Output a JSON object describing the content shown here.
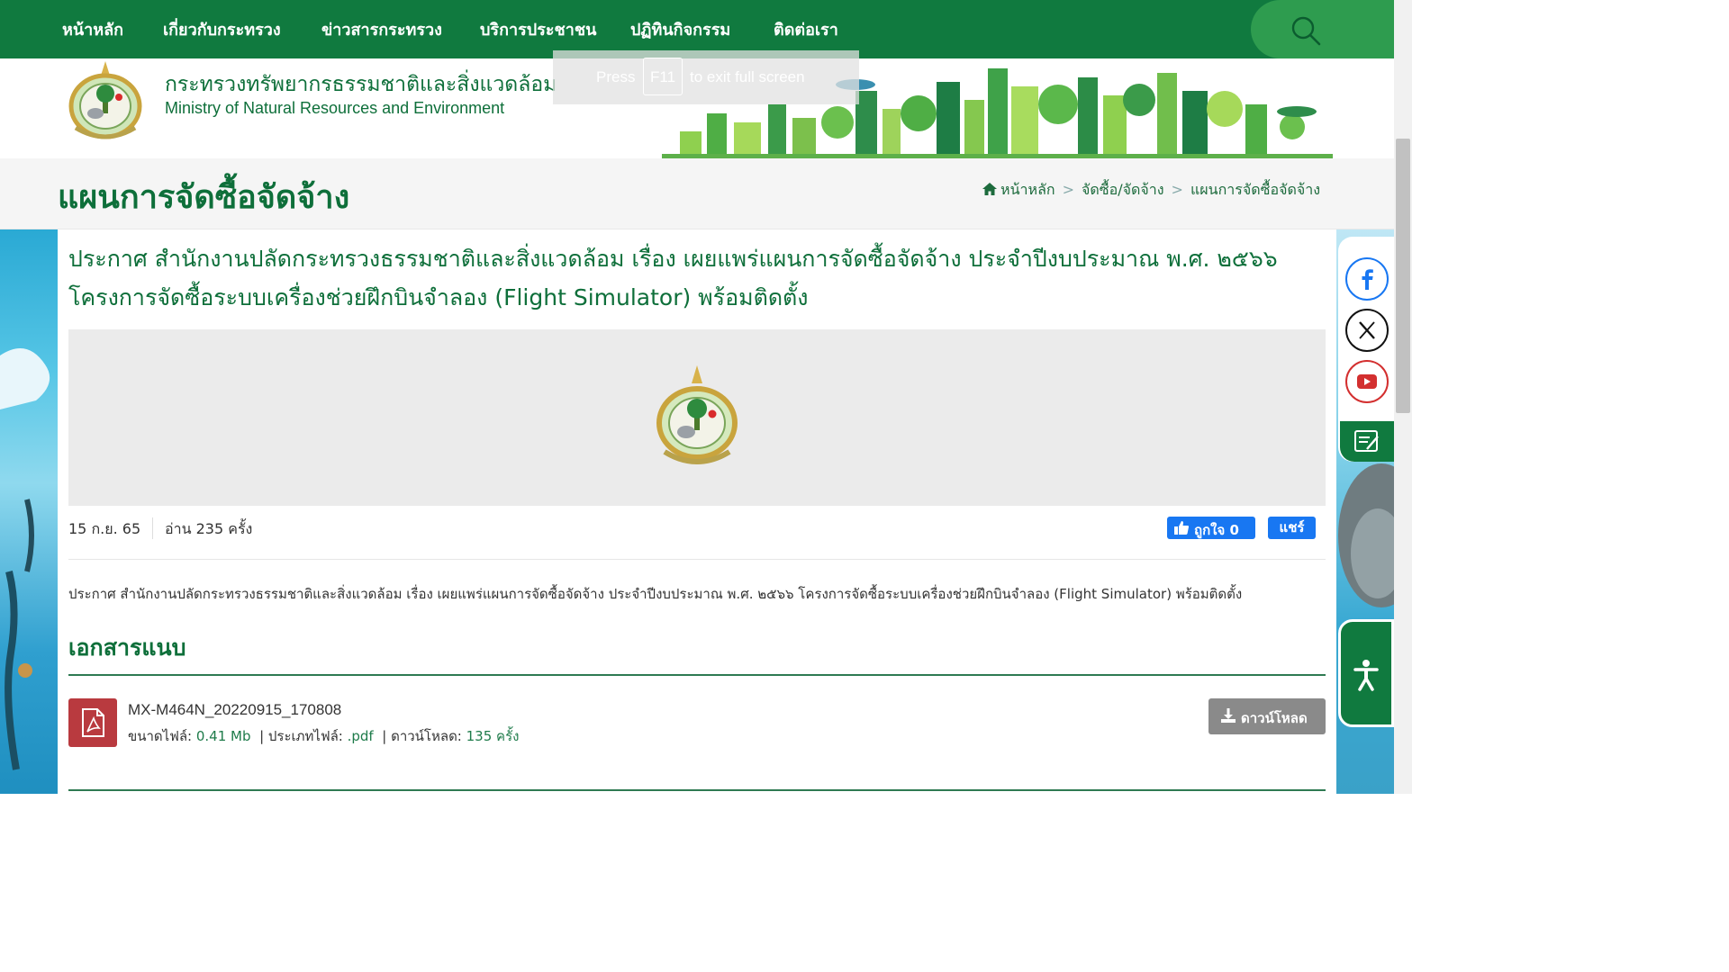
{
  "nav": {
    "items": [
      "หน้าหลัก",
      "เกี่ยวกับกระทรวง",
      "ข่าวสารกระทรวง",
      "บริการประชาชน",
      "ปฏิทินกิจกรรม",
      "ติดต่อเรา"
    ],
    "search_icon": "search-icon"
  },
  "header": {
    "ministry_th": "กระทรวงทรัพยากรธรรมชาติและสิ่งแวดล้อม",
    "ministry_en": "Ministry of Natural Resources and Environment"
  },
  "fullscreen_toast": {
    "press": "Press",
    "key": "F11",
    "rest": "to exit full screen"
  },
  "page": {
    "title": "แผนการจัดซื้อจัดจ้าง",
    "breadcrumb": [
      "หน้าหลัก",
      "จัดซื้อ/จัดจ้าง",
      "แผนการจัดซื้อจัดจ้าง"
    ]
  },
  "article": {
    "headline": "ประกาศ สำนักงานปลัดกระทรวงธรรมชาติและสิ่งแวดล้อม เรื่อง เผยแพร่แผนการจัดซื้อจัดจ้าง ประจำปีงบประมาณ พ.ศ. ๒๕๖๖ โครงการจัดซื้อระบบเครื่องช่วยฝึกบินจำลอง (Flight Simulator) พร้อมติดตั้ง",
    "date": "15 ก.ย. 65",
    "reads": "อ่าน 235 ครั้ง",
    "like_label": "ถูกใจ 0",
    "share_label": "แชร์",
    "body": "ประกาศ สำนักงานปลัดกระทรวงธรรมชาติและสิ่งแวดล้อม เรื่อง เผยแพร่แผนการจัดซื้อจัดจ้าง ประจำปีงบประมาณ พ.ศ. ๒๕๖๖ โครงการจัดซื้อระบบเครื่องช่วยฝึกบินจำลอง (Flight Simulator) พร้อมติดตั้ง"
  },
  "attachments": {
    "heading": "เอกสารแนบ",
    "files": [
      {
        "name": "MX-M464N_20220915_170808",
        "size_label": "ขนาดไฟล์:",
        "size": "0.41 Mb",
        "type_label": "| ประเภทไฟล์:",
        "type": ".pdf",
        "downloads_label": "| ดาวน์โหลด:",
        "downloads": "135 ครั้ง",
        "button": "ดาวน์โหลด"
      }
    ]
  },
  "social": [
    "facebook-icon",
    "x-icon",
    "youtube-icon"
  ],
  "colors": {
    "brand_green": "#107a3f",
    "facebook_blue": "#1877f2",
    "youtube_red": "#d32f2f",
    "pdf_red": "#b93a3f"
  }
}
